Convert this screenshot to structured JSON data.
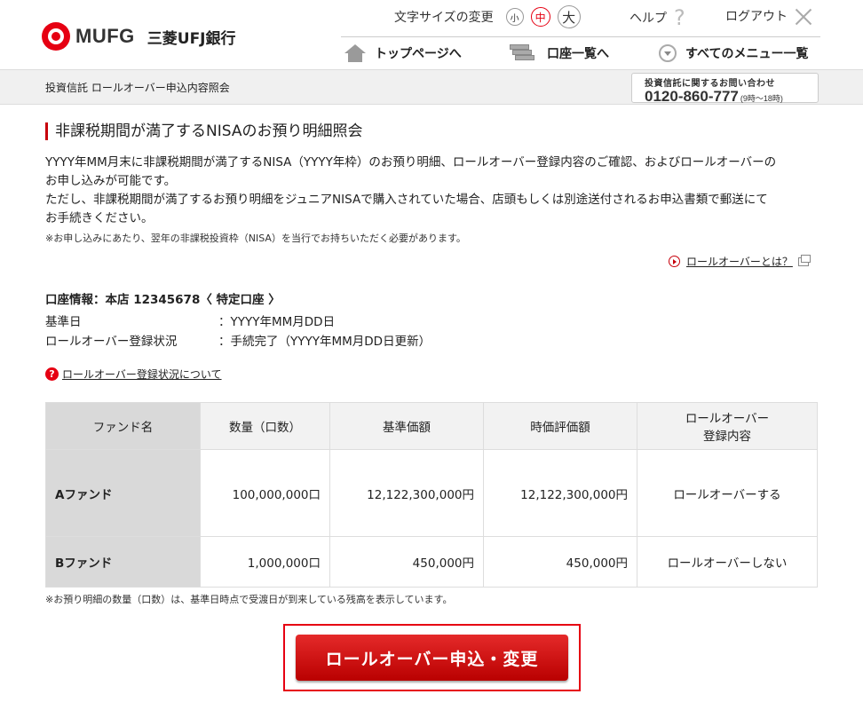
{
  "brand": {
    "mufg": "MUFG",
    "bank": "三菱UFJ銀行",
    "logo_color": "#e60012"
  },
  "util": {
    "font_size_label": "文字サイズの変更",
    "font_small": "小",
    "font_medium": "中",
    "font_large": "大",
    "help": "ヘルプ",
    "logout": "ログアウト"
  },
  "nav": {
    "top": "トップページへ",
    "accounts": "口座一覧へ",
    "menu": "すべてのメニュー一覧"
  },
  "breadcrumb": "投資信託 ロールオーバー申込内容照会",
  "contact": {
    "title": "投資信託に関するお問い合わせ",
    "phone": "0120-860-777",
    "hours": "(9時～18時)"
  },
  "main": {
    "heading": "非課税期間が満了するNISAのお預り明細照会",
    "intro_lines": [
      "YYYY年MM月末に非課税期間が満了するNISA（YYYY年枠）のお預り明細、ロールオーバー登録内容のご確認、およびロールオーバーの",
      "お申し込みが可能です。",
      "ただし、非課税期間が満了するお預り明細をジュニアNISAで購入されていた場合、店頭もしくは別途送付されるお申込書類で郵送にて",
      "お手続きください。"
    ],
    "note1": "※お申し込みにあたり、翌年の非課税投資枠（NISA）を当行でお持ちいただく必要があります。",
    "rollover_what": "ロールオーバーとは？",
    "account_info": "口座情報：本店 12345678〈 特定口座 〉",
    "base_date_label": "基準日",
    "base_date_value": "：YYYY年MM月DD日",
    "status_label": "ロールオーバー登録状況",
    "status_value": "：手続完了（YYYY年MM月DD日更新）",
    "status_link": "ロールオーバー登録状況について",
    "note2": "※お預り明細の数量（口数）は、基準日時点で受渡日が到来している残高を表示しています。",
    "cta": "ロールオーバー申込・変更"
  },
  "table": {
    "headers": [
      "ファンド名",
      "数量（口数）",
      "基準価額",
      "時価評価額",
      "ロールオーバー",
      "登録内容"
    ],
    "rows": [
      {
        "name": "Aファンド",
        "qty": "100,000,000口",
        "price": "12,122,300,000円",
        "value": "12,122,300,000円",
        "rollover": "ロールオーバーする"
      },
      {
        "name": "Bファンド",
        "qty": "1,000,000口",
        "price": "450,000円",
        "value": "450,000円",
        "rollover": "ロールオーバーしない"
      }
    ]
  }
}
